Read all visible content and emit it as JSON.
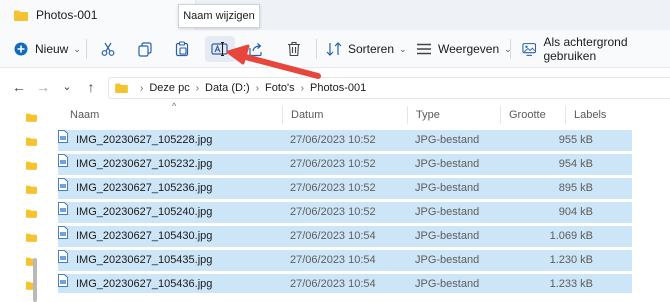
{
  "window": {
    "tab_title": "Photos-001",
    "tab_close": "×"
  },
  "tooltip": "Naam wijzigen",
  "toolbar": {
    "new_label": "Nieuw",
    "sort_label": "Sorteren",
    "view_label": "Weergeven",
    "background_label": "Als achtergrond gebruiken"
  },
  "breadcrumb": [
    "Deze pc",
    "Data (D:)",
    "Foto's",
    "Photos-001"
  ],
  "columns": {
    "name": "Naam",
    "date": "Datum",
    "type": "Type",
    "size": "Grootte",
    "labels": "Labels"
  },
  "files": [
    {
      "name": "IMG_20230627_105228.jpg",
      "date": "27/06/2023 10:52",
      "type": "JPG-bestand",
      "size": "955 kB"
    },
    {
      "name": "IMG_20230627_105232.jpg",
      "date": "27/06/2023 10:52",
      "type": "JPG-bestand",
      "size": "954 kB"
    },
    {
      "name": "IMG_20230627_105236.jpg",
      "date": "27/06/2023 10:52",
      "type": "JPG-bestand",
      "size": "895 kB"
    },
    {
      "name": "IMG_20230627_105240.jpg",
      "date": "27/06/2023 10:52",
      "type": "JPG-bestand",
      "size": "904 kB"
    },
    {
      "name": "IMG_20230627_105430.jpg",
      "date": "27/06/2023 10:54",
      "type": "JPG-bestand",
      "size": "1.069 kB"
    },
    {
      "name": "IMG_20230627_105435.jpg",
      "date": "27/06/2023 10:54",
      "type": "JPG-bestand",
      "size": "1.230 kB"
    },
    {
      "name": "IMG_20230627_105436.jpg",
      "date": "27/06/2023 10:54",
      "type": "JPG-bestand",
      "size": "1.233 kB"
    }
  ],
  "colors": {
    "selection": "#cce5f7",
    "accent_blue": "#0f6cbd",
    "folder_yellow": "#f4c430",
    "annotation_arrow": "#e8453c"
  }
}
